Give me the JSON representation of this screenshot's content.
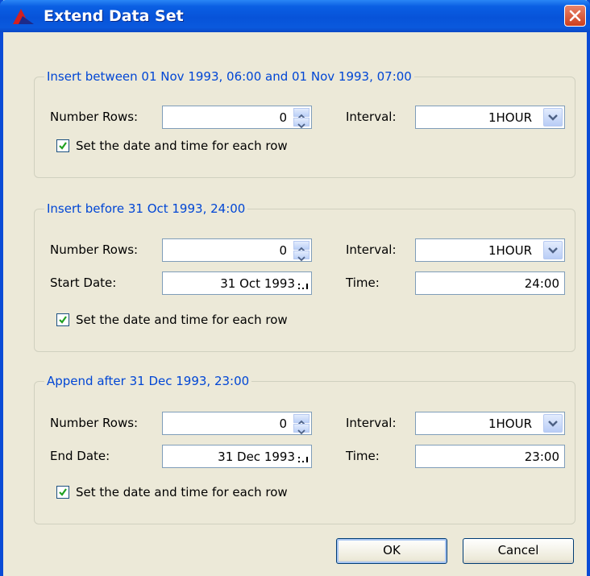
{
  "window": {
    "title": "Extend Data Set"
  },
  "sections": [
    {
      "title": "Insert between 01 Nov 1993, 06:00 and 01 Nov 1993, 07:00",
      "number_rows_label": "Number Rows:",
      "number_rows_value": "0",
      "interval_label": "Interval:",
      "interval_value": "1HOUR",
      "checkbox_label": "Set the date and time for each row",
      "checked": true
    },
    {
      "title": "Insert before 31 Oct 1993, 24:00",
      "number_rows_label": "Number Rows:",
      "number_rows_value": "0",
      "interval_label": "Interval:",
      "interval_value": "1HOUR",
      "date_label": "Start Date:",
      "date_value": "31 Oct 1993",
      "time_label": "Time:",
      "time_value": "24:00",
      "checkbox_label": "Set the date and time for each row",
      "checked": true
    },
    {
      "title": "Append after 31 Dec 1993, 23:00",
      "number_rows_label": "Number Rows:",
      "number_rows_value": "0",
      "interval_label": "Interval:",
      "interval_value": "1HOUR",
      "date_label": "End Date:",
      "date_value": "31 Dec 1993",
      "time_label": "Time:",
      "time_value": "23:00",
      "checkbox_label": "Set the date and time for each row",
      "checked": true
    }
  ],
  "buttons": {
    "ok": "OK",
    "cancel": "Cancel"
  },
  "icons": {
    "app": "app-logo-icon",
    "close": "close-icon",
    "spin": "spinner-arrows-icon",
    "dropdown": "chevron-down-icon",
    "date": "date-picker-icon",
    "check": "checkmark-icon"
  },
  "colors": {
    "title_bar": "#0a5fe3",
    "group_title": "#0046d5",
    "dialog_bg": "#ece9d8",
    "close": "#cc3f1e"
  }
}
